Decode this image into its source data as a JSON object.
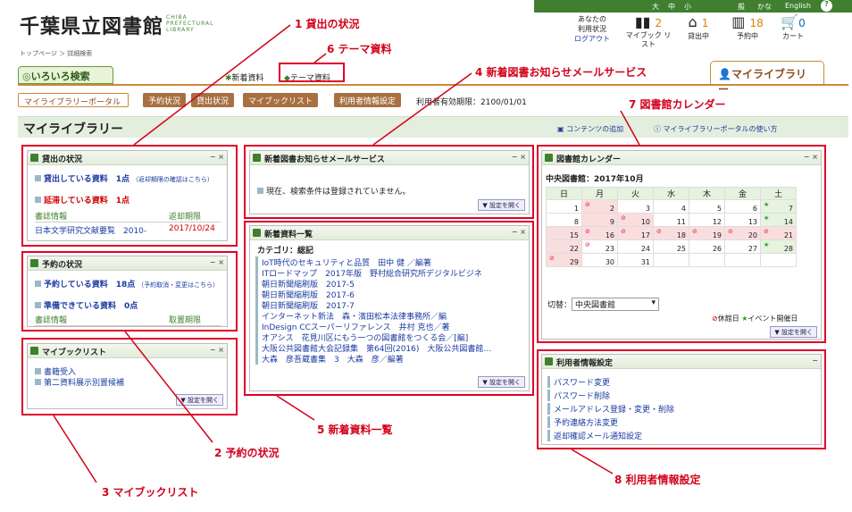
{
  "header": {
    "logo": "千葉県立図書館",
    "logo_en_1": "CHIBA",
    "logo_en_2": "PREFECTURAL",
    "logo_en_3": "LIBRARY",
    "breadcrumb": "トップページ ＞ 詳細検索",
    "font_large": "大",
    "font_mid": "中",
    "font_small": "小",
    "kana_kanji": "般",
    "kana": "かな",
    "english": "English",
    "help": "?",
    "status_line1": "あなたの",
    "status_line2": "利用状況",
    "logout": "ログアウト",
    "mybook_label": "マイブック リスト",
    "mybook_count": "2",
    "borrowing_label": "貸出中",
    "borrowing_count": "1",
    "reserving_label": "予約中",
    "reserving_count": "18",
    "cart_label": "カート",
    "cart_count": "0"
  },
  "tabs": {
    "search": "いろいろ検索",
    "new_items": "新着資料",
    "theme": "テーマ資料",
    "mylibrary": "マイライブラリー"
  },
  "buttons": {
    "portal": "マイライブラリーポータル",
    "reservation": "予約状況",
    "lending": "貸出状況",
    "mybooklist": "マイブックリスト",
    "user_settings": "利用者情報設定",
    "expiry": "利用者有効期限：2100/01/01"
  },
  "page_title": "マイライブラリー",
  "add_content": "コンテンツの追加",
  "how_to_use": "マイライブラリーポータルの使い方",
  "panels": {
    "lending": {
      "title": "貸出の状況",
      "borrowing": "貸出している資料　1点",
      "borrowing_note": "（返却期限の確認はこちら）",
      "overdue": "延滞している資料　1点",
      "col1": "書誌情報",
      "col2": "返却期限",
      "item": "日本文学研究文献要覧　2010-",
      "due": "2017/10/24"
    },
    "reservation": {
      "title": "予約の状況",
      "reserving": "予約している資料　18点",
      "reserving_note": "（予約取消・変更はこちら）",
      "ready": "準備できている資料　0点",
      "col1": "書誌情報",
      "col2": "取置期限"
    },
    "mybook": {
      "title": "マイブックリスト",
      "item1": "書籍受入",
      "item2": "第二資料展示別置候補",
      "open": "設定を開く"
    },
    "mail": {
      "title": "新着図書お知らせメールサービス",
      "msg": "現在、検索条件は登録されていません。",
      "open": "設定を開く"
    },
    "new_list": {
      "title": "新着資料一覧",
      "category": "カテゴリ：総記",
      "items": [
        "IoT時代のセキュリティと品質　田中 健 ／編著",
        "ITロードマップ　2017年版　野村総合研究所デジタルビジネ",
        "朝日新聞縮刷版　2017-5",
        "朝日新聞縮刷版　2017-6",
        "朝日新聞縮刷版　2017-7",
        "インターネット新法　森・濱田松本法律事務所／編",
        "InDesign CCスーパーリファレンス　井村 克也／著",
        "オアシス　花見川区にもう一つの図書館をつくる会／[編]",
        "大阪公共図書館大会記録集　第64回(2016)　大阪公共図書館…",
        "大森　彦吾蔵書集　3　大森　彦／編著"
      ],
      "open": "設定を開く"
    },
    "calendar": {
      "title": "図書館カレンダー",
      "library": "中央図書館：2017年10月",
      "days": [
        "日",
        "月",
        "火",
        "水",
        "木",
        "金",
        "土"
      ],
      "weeks": [
        [
          "1",
          "2",
          "3",
          "4",
          "5",
          "6",
          "7"
        ],
        [
          "8",
          "9",
          "10",
          "11",
          "12",
          "13",
          "14"
        ],
        [
          "15",
          "16",
          "17",
          "18",
          "19",
          "20",
          "21"
        ],
        [
          "22",
          "23",
          "24",
          "25",
          "26",
          "27",
          "28"
        ],
        [
          "29",
          "30",
          "31",
          "",
          "",
          "",
          ""
        ]
      ],
      "switch_label": "切替：",
      "switch_value": "中央図書館",
      "legend_closed": "休館日",
      "legend_event": "イベント開催日",
      "open": "設定を開く"
    },
    "user": {
      "title": "利用者情報設定",
      "items": [
        "パスワード変更",
        "パスワード削除",
        "メールアドレス登録・変更・削除",
        "予約連絡方法変更",
        "返却確認メール通知設定"
      ]
    }
  },
  "annotations": {
    "a1": "1 貸出の状況",
    "a2": "2 予約の状況",
    "a3": "3 マイブックリスト",
    "a4": "4 新着図書お知らせメールサービス",
    "a5": "5 新着資料一覧",
    "a6": "6 テーマ資料",
    "a7": "7 図書館カレンダー",
    "a8": "8 利用者情報設定"
  },
  "colors": {
    "accent": "#e0002a",
    "green": "#3f7f2f",
    "brown": "#a87040"
  }
}
